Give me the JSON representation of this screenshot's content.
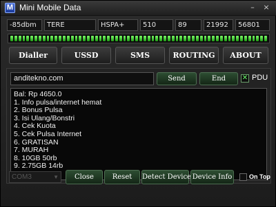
{
  "window": {
    "title": "Mini Mobile Data",
    "icon_letter": "M",
    "minimize_glyph": "–",
    "close_glyph": "×"
  },
  "status": {
    "signal": "-85dbm",
    "operator": "TERE",
    "network_type": "HSPA+",
    "mcc": "510",
    "mnc": "89",
    "lac": "21992",
    "cell_id": "56801"
  },
  "signal_level": {
    "segments": 64
  },
  "tabs": [
    "Dialler",
    "USSD",
    "SMS",
    "ROUTING",
    "ABOUT"
  ],
  "ussd": {
    "input_value": "anditekno.com",
    "send_label": "Send",
    "end_label": "End",
    "pdu_label": "PDU",
    "pdu_checked": true,
    "response_lines": [
      "Bal: Rp 4650.0",
      "1. Info pulsa/internet hemat",
      "2. Bonus Pulsa",
      "3. Isi Ulang/Bonstri",
      "4. Cek Kuota",
      "5. Cek Pulsa Internet",
      "6. GRATISAN",
      "7. MURAH",
      "8. 10GB 50rb",
      "9. 2.75GB 14rb"
    ]
  },
  "bottom": {
    "port": "COM3",
    "close_label": "Close",
    "reset_label": "Reset",
    "detect_label": "Detect Device",
    "info_label": "Device Info",
    "ontop_label": "On Top",
    "ontop_checked": false
  },
  "colors": {
    "accent_green": "#1f9a14",
    "button_green": "#2d4d32",
    "background": "#1c1c1c"
  }
}
